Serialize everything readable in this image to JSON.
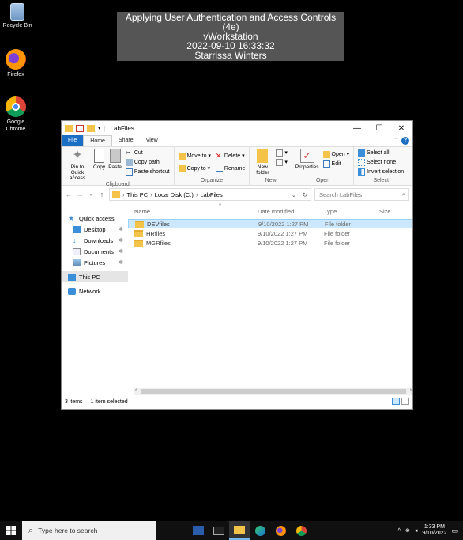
{
  "desktop": {
    "icons": [
      {
        "label": "Recycle Bin"
      },
      {
        "label": "Firefox"
      },
      {
        "label": "Google Chrome"
      }
    ]
  },
  "banner": {
    "line1": "Applying User Authentication and Access Controls (4e)",
    "line2": "vWorkstation",
    "line3": "2022-09-10 16:33:32",
    "line4": "Starrissa Winters"
  },
  "window": {
    "title": "LabFiles",
    "minimize": "—",
    "maximize": "☐",
    "close": "✕"
  },
  "tabs": {
    "file": "File",
    "home": "Home",
    "share": "Share",
    "view": "View"
  },
  "ribbon": {
    "clipboard": {
      "name": "Clipboard",
      "pin": "Pin to Quick access",
      "copy": "Copy",
      "paste": "Paste",
      "cut": "Cut",
      "copy_path": "Copy path",
      "paste_shortcut": "Paste shortcut"
    },
    "organize": {
      "name": "Organize",
      "move_to": "Move to ▾",
      "copy_to": "Copy to ▾",
      "delete": "Delete ▾",
      "rename": "Rename"
    },
    "new": {
      "name": "New",
      "new_folder": "New folder"
    },
    "open": {
      "name": "Open",
      "properties": "Properties",
      "open": "Open ▾",
      "edit": "Edit"
    },
    "select": {
      "name": "Select",
      "select_all": "Select all",
      "select_none": "Select none",
      "invert": "Invert selection"
    }
  },
  "address": {
    "crumbs": [
      "This PC",
      "Local Disk (C:)",
      "LabFiles"
    ],
    "search_placeholder": "Search LabFiles"
  },
  "navpane": {
    "quick_access": "Quick access",
    "desktop": "Desktop",
    "downloads": "Downloads",
    "documents": "Documents",
    "pictures": "Pictures",
    "this_pc": "This PC",
    "network": "Network"
  },
  "columns": {
    "name": "Name",
    "date": "Date modified",
    "type": "Type",
    "size": "Size"
  },
  "files": [
    {
      "name": "DEVfiles",
      "date": "9/10/2022 1:27 PM",
      "type": "File folder",
      "selected": true
    },
    {
      "name": "HRfiles",
      "date": "9/10/2022 1:27 PM",
      "type": "File folder",
      "selected": false
    },
    {
      "name": "MGRfiles",
      "date": "9/10/2022 1:27 PM",
      "type": "File folder",
      "selected": false
    }
  ],
  "status": {
    "count": "3 items",
    "selected": "1 item selected"
  },
  "taskbar": {
    "search_placeholder": "Type here to search",
    "time": "1:33 PM",
    "date": "9/10/2022"
  }
}
